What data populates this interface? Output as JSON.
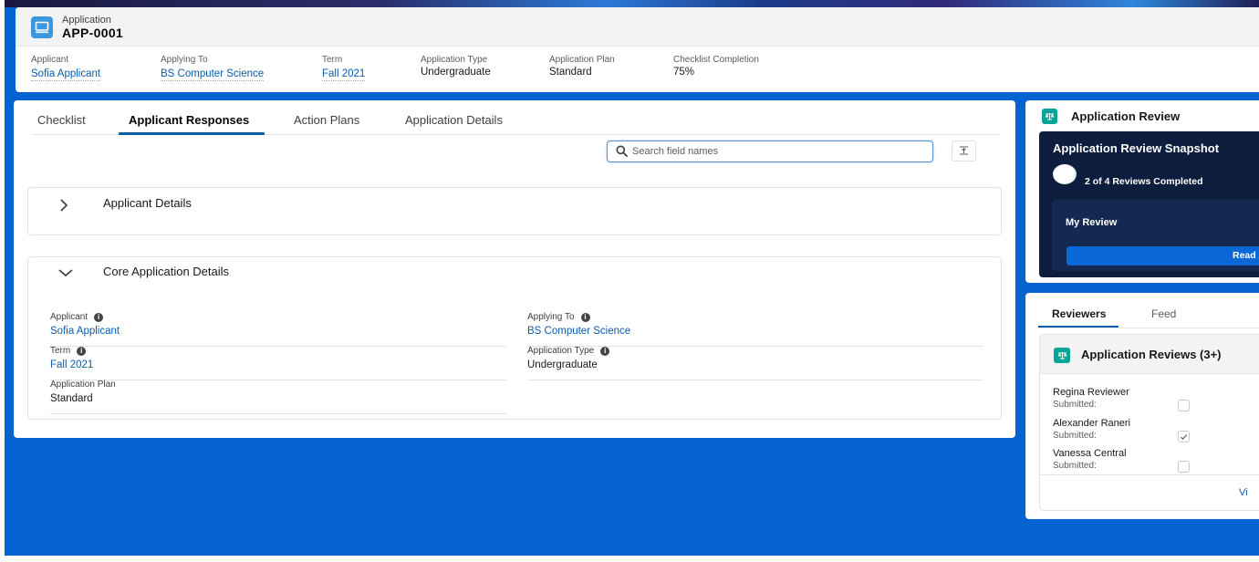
{
  "record": {
    "object_label": "Application",
    "name": "APP-0001",
    "icon": "desktop-icon",
    "highlights": [
      {
        "label": "Applicant",
        "value": "Sofia Applicant",
        "link": true
      },
      {
        "label": "Applying To",
        "value": "BS Computer Science",
        "link": true
      },
      {
        "label": "Term",
        "value": "Fall 2021",
        "link": true
      },
      {
        "label": "Application Type",
        "value": "Undergraduate",
        "link": false
      },
      {
        "label": "Application Plan",
        "value": "Standard",
        "link": false
      },
      {
        "label": "Checklist Completion",
        "value": "75%",
        "link": false
      }
    ]
  },
  "main": {
    "tabs": [
      {
        "label": "Checklist",
        "active": false
      },
      {
        "label": "Applicant Responses",
        "active": true
      },
      {
        "label": "Action Plans",
        "active": false
      },
      {
        "label": "Application Details",
        "active": false
      }
    ],
    "search": {
      "placeholder": "Search field names",
      "value": ""
    },
    "collapse_icon": "collapse-all-icon",
    "sections": [
      {
        "title": "Applicant Details",
        "expanded": false
      },
      {
        "title": "Core Application Details",
        "expanded": true,
        "fields": [
          {
            "label": "Applicant",
            "value": "Sofia Applicant",
            "link": true,
            "info": true
          },
          {
            "label": "Applying To",
            "value": "BS Computer Science",
            "link": true,
            "info": true
          },
          {
            "label": "Term",
            "value": "Fall 2021",
            "link": true,
            "info": true
          },
          {
            "label": "Application Type",
            "value": "Undergraduate",
            "link": false,
            "info": true
          },
          {
            "label": "Application Plan",
            "value": "Standard",
            "link": false,
            "info": false
          }
        ]
      }
    ]
  },
  "review": {
    "title": "Application Review",
    "icon": "scales-icon",
    "snapshot": {
      "title": "Application Review Snapshot",
      "completed": 2,
      "total": 4,
      "count_text": "2 of 4 Reviews Completed",
      "my_review_label": "My Review",
      "button_label": "Read A"
    }
  },
  "reviewers": {
    "tabs": [
      {
        "label": "Reviewers",
        "active": true
      },
      {
        "label": "Feed",
        "active": false
      }
    ],
    "list_title": "Application Reviews (3+)",
    "items": [
      {
        "name": "Regina Reviewer",
        "submitted_label": "Submitted:",
        "submitted": false
      },
      {
        "name": "Alexander Raneri",
        "submitted_label": "Submitted:",
        "submitted": true
      },
      {
        "name": "Vanessa Central",
        "submitted_label": "Submitted:",
        "submitted": false
      }
    ],
    "footer_link": "Vi"
  },
  "colors": {
    "brand_blue": "#0563d1",
    "link": "#0b5cab",
    "snapshot_bg": "#0d1d3d",
    "teal_icon": "#06a59a",
    "record_icon": "#3c97dd"
  }
}
